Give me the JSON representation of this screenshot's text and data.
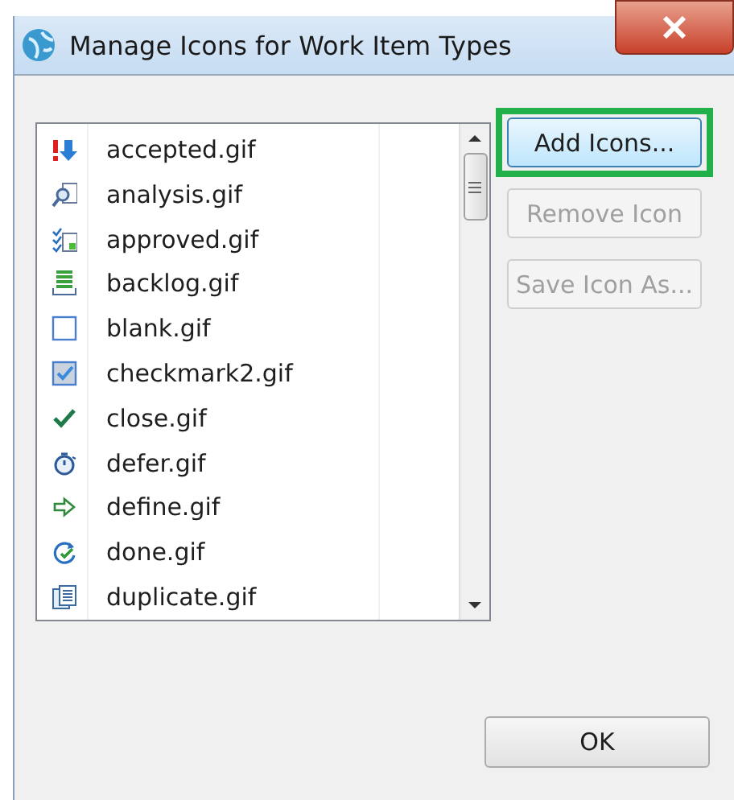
{
  "window": {
    "title": "Manage Icons for Work Item Types"
  },
  "icons": [
    {
      "name": "accepted.gif"
    },
    {
      "name": "analysis.gif"
    },
    {
      "name": "approved.gif"
    },
    {
      "name": "backlog.gif"
    },
    {
      "name": "blank.gif"
    },
    {
      "name": "checkmark2.gif"
    },
    {
      "name": "close.gif"
    },
    {
      "name": "defer.gif"
    },
    {
      "name": "define.gif"
    },
    {
      "name": "done.gif"
    },
    {
      "name": "duplicate.gif"
    }
  ],
  "buttons": [
    {
      "label": "Add Icons...",
      "disabled": false,
      "highlighted": true
    },
    {
      "label": "Remove Icon",
      "disabled": true,
      "highlighted": false
    },
    {
      "label": "Save Icon As...",
      "disabled": true,
      "highlighted": false
    }
  ],
  "ok_button": {
    "label": "OK"
  }
}
